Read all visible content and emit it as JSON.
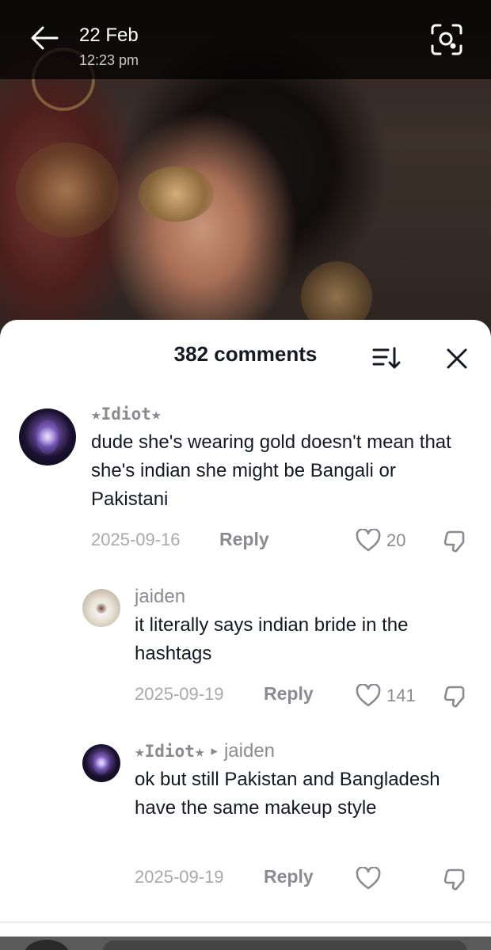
{
  "header": {
    "date": "22 Feb",
    "time": "12:23 pm",
    "back_icon": "back-arrow-icon",
    "lens_icon": "lens-search-icon"
  },
  "sheet": {
    "title": "382 comments",
    "sort_icon": "sort-icon",
    "close_icon": "close-icon"
  },
  "comments": [
    {
      "username": "★Idiot★",
      "text": "dude she's wearing gold doesn't mean that she's indian she might be Bangali or Pakistani",
      "date": "2025-09-16",
      "reply_label": "Reply",
      "likes": "20"
    },
    {
      "username": "jaiden",
      "text": "it literally says indian bride in the hashtags",
      "date": "2025-09-19",
      "reply_label": "Reply",
      "likes": "141"
    },
    {
      "username": "★Idiot★",
      "reply_to": "jaiden",
      "text": "ok but still Pakistan and Bangladesh have the same makeup style",
      "date": "2025-09-19",
      "reply_label": "Reply",
      "likes": ""
    }
  ],
  "colors": {
    "text_primary": "#161823",
    "text_secondary": "#8a8b91",
    "sheet_bg": "#ffffff"
  }
}
